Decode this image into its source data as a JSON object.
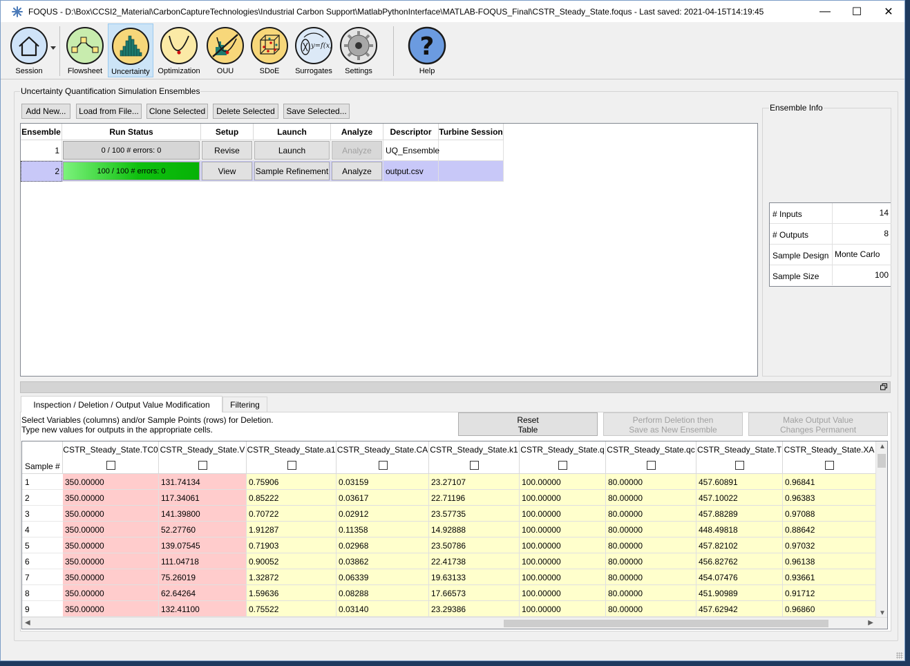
{
  "window": {
    "title": "FOQUS - D:\\Box\\CCSI2_Material\\CarbonCaptureTechnologies\\Industrial Carbon Support\\MatlabPythonInterface\\MATLAB-FOQUS_Final\\CSTR_Steady_State.foqus - Last saved: 2021-04-15T14:19:45",
    "minimize": "—",
    "maximize": "☐",
    "close": "✕"
  },
  "toolbar": {
    "session": "Session",
    "flowsheet": "Flowsheet",
    "uncertainty": "Uncertainty",
    "optimization": "Optimization",
    "ouu": "OUU",
    "sdoe": "SDoE",
    "surrogates": "Surrogates",
    "surrogates_formula": "y=f(x)",
    "settings": "Settings",
    "help": "Help",
    "help_glyph": "?"
  },
  "uq": {
    "group_title": "Uncertainty Quantification Simulation Ensembles",
    "buttons": {
      "add": "Add New...",
      "load": "Load from File...",
      "clone": "Clone Selected",
      "delete": "Delete Selected",
      "save": "Save Selected..."
    },
    "headers": {
      "ensemble": "Ensemble",
      "run_status": "Run Status",
      "setup": "Setup",
      "launch": "Launch",
      "analyze": "Analyze",
      "descriptor": "Descriptor",
      "turbine": "Turbine Session"
    },
    "rows": [
      {
        "id": "1",
        "status": "0 / 100  # errors: 0",
        "progress": 0,
        "setup": "Revise",
        "launch": "Launch",
        "analyze": "Analyze",
        "descriptor": "UQ_Ensemble",
        "turbine": ""
      },
      {
        "id": "2",
        "status": "100 / 100  # errors: 0",
        "progress": 100,
        "setup": "View",
        "launch": "Sample Refinement",
        "analyze": "Analyze",
        "descriptor": "output.csv",
        "turbine": ""
      }
    ]
  },
  "info": {
    "title": "Ensemble Info",
    "inputs_label": "# Inputs",
    "inputs": "14",
    "outputs_label": "# Outputs",
    "outputs": "8",
    "design_label": "Sample Design",
    "design": "Monte Carlo",
    "size_label": "Sample Size",
    "size": "100"
  },
  "tabs": {
    "inspection": "Inspection / Deletion / Output Value Modification",
    "filtering": "Filtering"
  },
  "inspection": {
    "line1": "Select Variables (columns) and/or Sample Points (rows) for Deletion.",
    "line2": "Type new values for outputs in the appropriate cells.",
    "reset_1": "Reset",
    "reset_2": "Table",
    "perform_1": "Perform Deletion then",
    "perform_2": "Save as New Ensemble",
    "make_1": "Make Output Value",
    "make_2": "Changes Permanent"
  },
  "grid": {
    "row_header": "Sample #",
    "columns": [
      "CSTR_Steady_State.TC0",
      "CSTR_Steady_State.V",
      "CSTR_Steady_State.a1",
      "CSTR_Steady_State.CA",
      "CSTR_Steady_State.k1",
      "CSTR_Steady_State.q",
      "CSTR_Steady_State.qc",
      "CSTR_Steady_State.T",
      "CSTR_Steady_State.XA"
    ],
    "rows": [
      {
        "n": "1",
        "v": [
          "350.00000",
          "131.74134",
          "0.75906",
          "0.03159",
          "23.27107",
          "100.00000",
          "80.00000",
          "457.60891",
          "0.96841"
        ]
      },
      {
        "n": "2",
        "v": [
          "350.00000",
          "117.34061",
          "0.85222",
          "0.03617",
          "22.71196",
          "100.00000",
          "80.00000",
          "457.10022",
          "0.96383"
        ]
      },
      {
        "n": "3",
        "v": [
          "350.00000",
          "141.39800",
          "0.70722",
          "0.02912",
          "23.57735",
          "100.00000",
          "80.00000",
          "457.88289",
          "0.97088"
        ]
      },
      {
        "n": "4",
        "v": [
          "350.00000",
          "52.27760",
          "1.91287",
          "0.11358",
          "14.92888",
          "100.00000",
          "80.00000",
          "448.49818",
          "0.88642"
        ]
      },
      {
        "n": "5",
        "v": [
          "350.00000",
          "139.07545",
          "0.71903",
          "0.02968",
          "23.50786",
          "100.00000",
          "80.00000",
          "457.82102",
          "0.97032"
        ]
      },
      {
        "n": "6",
        "v": [
          "350.00000",
          "111.04718",
          "0.90052",
          "0.03862",
          "22.41738",
          "100.00000",
          "80.00000",
          "456.82762",
          "0.96138"
        ]
      },
      {
        "n": "7",
        "v": [
          "350.00000",
          "75.26019",
          "1.32872",
          "0.06339",
          "19.63133",
          "100.00000",
          "80.00000",
          "454.07476",
          "0.93661"
        ]
      },
      {
        "n": "8",
        "v": [
          "350.00000",
          "62.64264",
          "1.59636",
          "0.08288",
          "17.66573",
          "100.00000",
          "80.00000",
          "451.90989",
          "0.91712"
        ]
      },
      {
        "n": "9",
        "v": [
          "350.00000",
          "132.41100",
          "0.75522",
          "0.03140",
          "23.29386",
          "100.00000",
          "80.00000",
          "457.62942",
          "0.96860"
        ]
      }
    ]
  }
}
